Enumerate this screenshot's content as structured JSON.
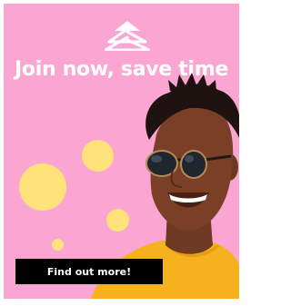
{
  "ad": {
    "headline": "Join now, save time",
    "cta_label": "Find out more!",
    "logo_icon": "triangle-logo-icon",
    "colors": {
      "background": "#fba6d2",
      "dots": "#ffe27a",
      "button": "#000000",
      "text": "#ffffff"
    }
  }
}
